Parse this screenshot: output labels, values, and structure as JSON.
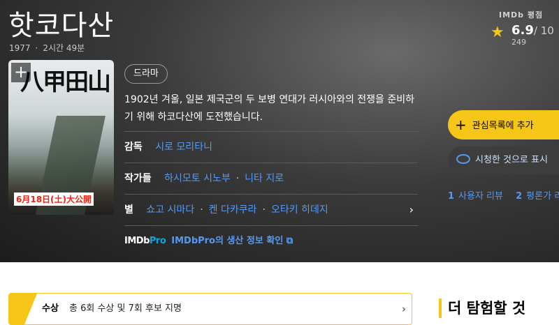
{
  "title": "핫코다산",
  "meta": {
    "year": "1977",
    "runtime": "2시간 49분"
  },
  "rating": {
    "label": "IMDb 평점",
    "score": "6.9",
    "out_of": "/ 10",
    "votes": "249"
  },
  "poster": {
    "title": "八甲田山",
    "date": "6月18日(土)大公開"
  },
  "genre": "드라마",
  "plot": "1902년 겨울, 일본 제국군의 두 보병 연대가 러시아와의 전쟁을 준비하기 위해 하코다산에 도전했습니다.",
  "director": {
    "label": "감독",
    "names": [
      "시로 모리타니"
    ]
  },
  "writers": {
    "label": "작가들",
    "names": [
      "하시모토 시노부",
      "니타 지로"
    ]
  },
  "stars": {
    "label": "별",
    "names": [
      "쇼고 시마다",
      "켄 다카쿠라",
      "오타키 히데지"
    ]
  },
  "pro": {
    "logo_a": "IMDb",
    "logo_b": "Pro",
    "text": "IMDbPro의 생산 정보 확인 ⧉"
  },
  "actions": {
    "watchlist": "관심목록에 추가",
    "seen": "시청한 것으로 표시"
  },
  "reviews": {
    "user_count": "1",
    "user_label": "사용자 리뷰",
    "critic_count": "2",
    "critic_label": "평론가 리뷰"
  },
  "awards": {
    "label": "수상",
    "text": "총 6회 수상 및 7회 후보 지명"
  },
  "explore": "더 탐험할 것",
  "colors": {
    "accent": "#f5c518",
    "link": "#5799ef",
    "hero_bg": "#2b2b2b"
  }
}
